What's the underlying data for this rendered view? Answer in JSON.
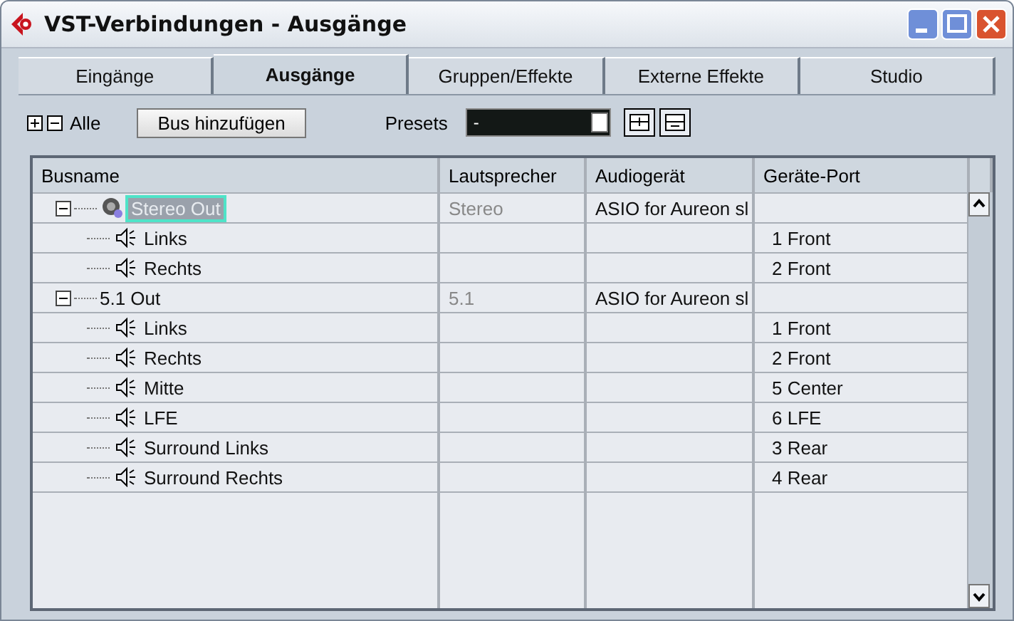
{
  "window": {
    "title": "VST-Verbindungen - Ausgänge"
  },
  "tabs": [
    {
      "label": "Eingänge",
      "selected": false
    },
    {
      "label": "Ausgänge",
      "selected": true
    },
    {
      "label": "Gruppen/Effekte",
      "selected": false
    },
    {
      "label": "Externe Effekte",
      "selected": false
    },
    {
      "label": "Studio",
      "selected": false
    }
  ],
  "toolbar": {
    "all_label": "Alle",
    "add_button": "Bus hinzufügen",
    "presets_label": "Presets",
    "preset_value": "-"
  },
  "table": {
    "columns": [
      "Busname",
      "Lautsprecher",
      "Audiogerät",
      "Geräte-Port"
    ],
    "buses": [
      {
        "name": "Stereo Out",
        "selected": true,
        "expanded": true,
        "speaker": "Stereo",
        "device": "ASIO for Aureon sl",
        "children": [
          {
            "name": "Links",
            "port": "1 Front"
          },
          {
            "name": "Rechts",
            "port": "2 Front"
          }
        ]
      },
      {
        "name": "5.1 Out",
        "selected": false,
        "expanded": true,
        "speaker": "5.1",
        "device": "ASIO for Aureon sl",
        "children": [
          {
            "name": "Links",
            "port": "1 Front"
          },
          {
            "name": "Rechts",
            "port": "2 Front"
          },
          {
            "name": "Mitte",
            "port": "5 Center"
          },
          {
            "name": "LFE",
            "port": "6 LFE"
          },
          {
            "name": "Surround Links",
            "port": "3 Rear"
          },
          {
            "name": "Surround Rechts",
            "port": "4 Rear"
          }
        ]
      }
    ]
  }
}
